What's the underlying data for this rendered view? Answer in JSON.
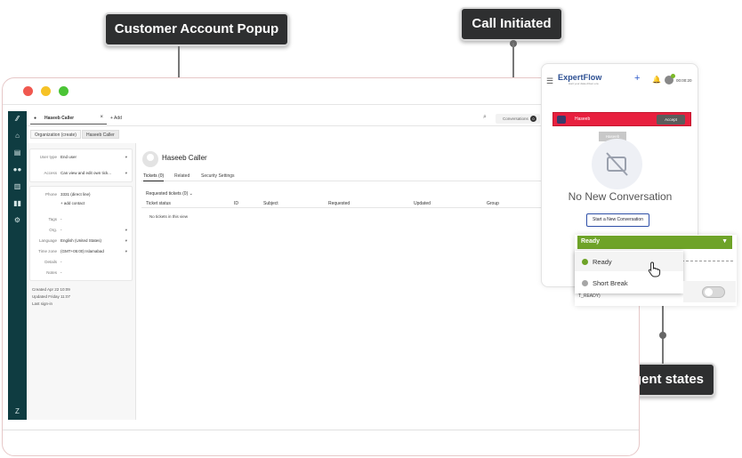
{
  "callouts": {
    "customer_popup": "Customer Account Popup",
    "call_initiated": "Call Initiated",
    "agent_states": "Agent states"
  },
  "zendesk": {
    "tab_label": "Haseeb Caller",
    "tab_close": "×",
    "add_tab": "+ Add",
    "conversations_label": "Conversations",
    "conversations_count": "0",
    "breadcrumbs": [
      "Organization (create)",
      "Haseeb Caller"
    ],
    "user_fields": {
      "user_type_label": "User type",
      "user_type_value": "End user",
      "access_label": "Access",
      "access_value": "Can view and edit own tick...",
      "phone_label": "Phone",
      "phone_value": "3331 (direct line)",
      "add_contact": "+ add contact",
      "tags_label": "Tags",
      "tags_value": "-",
      "org_label": "Org.",
      "org_value": "-",
      "language_label": "Language",
      "language_value": "English (United States)",
      "timezone_label": "Time zone",
      "timezone_value": "(GMT+05:00) Islamabad",
      "details_label": "Details",
      "details_value": "-",
      "notes_label": "Notes",
      "notes_value": "-"
    },
    "meta": {
      "created": "Created  Apr 22 10:09",
      "updated": "Updated  Friday 11:07",
      "last_sign_in": "Last sign-in"
    },
    "user_name": "Haseeb Caller",
    "subtabs": [
      "Tickets (0)",
      "Related",
      "Security Settings"
    ],
    "requested_label": "Requested tickets (0) ⌄",
    "table_headers": [
      "Ticket status",
      "ID",
      "Subject",
      "Requested",
      "Updated",
      "Group"
    ],
    "empty_message": "No tickets in this view"
  },
  "widget": {
    "logo": "ExpertFlow",
    "logo_tagline": "start your data-driven era",
    "timer": "00:00:20",
    "caller_name": "Haseeb",
    "accept_label": "Accept",
    "tooltip": "Haseeb",
    "no_conversation": "No New Conversation",
    "start_button": "Start a New Conversation",
    "state_selected": "Ready",
    "state_options": [
      {
        "label": "Ready",
        "color": "#6ea328"
      },
      {
        "label": "Short Break",
        "color": "#a6a6a6"
      }
    ],
    "partial_label": "T_READY)"
  },
  "icons": {
    "sidebar": [
      "logo-icon",
      "home-icon",
      "views-icon",
      "customers-icon",
      "organizations-icon",
      "reporting-icon",
      "admin-icon",
      "zendesk-icon"
    ]
  },
  "colors": {
    "sidebar": "#0f3c41",
    "call_bar": "#e8203f",
    "ready": "#6ea328",
    "callout_bg": "#2e2f30"
  }
}
